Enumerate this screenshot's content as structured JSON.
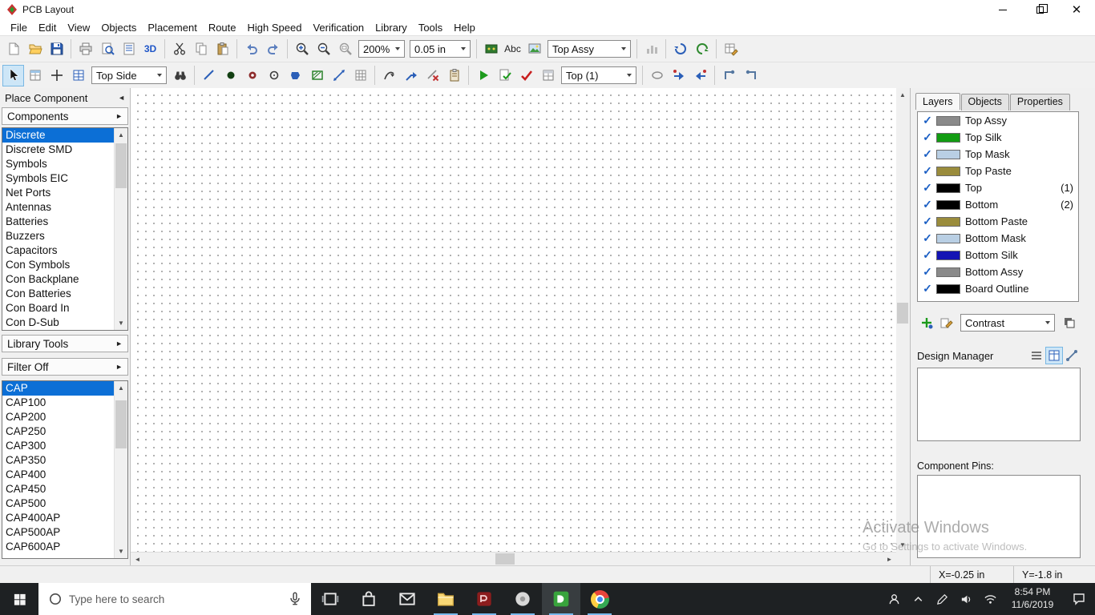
{
  "window": {
    "title": "PCB Layout"
  },
  "menu": {
    "items": [
      "File",
      "Edit",
      "View",
      "Objects",
      "Placement",
      "Route",
      "High Speed",
      "Verification",
      "Library",
      "Tools",
      "Help"
    ]
  },
  "toolbar_top": {
    "zoom": "200%",
    "grid": "0.05 in",
    "layer": "Top Assy",
    "view3d_label": "3D",
    "text_label": "Abc"
  },
  "toolbar_draw": {
    "side": "Top Side",
    "signal_layer": "Top (1)"
  },
  "left_panel": {
    "header": "Place Component",
    "components_label": "Components",
    "categories": [
      {
        "label": "Discrete",
        "selected": true
      },
      {
        "label": "Discrete SMD"
      },
      {
        "label": "Symbols"
      },
      {
        "label": "Symbols EIC"
      },
      {
        "label": "Net Ports"
      },
      {
        "label": "Antennas"
      },
      {
        "label": "Batteries"
      },
      {
        "label": "Buzzers"
      },
      {
        "label": "Capacitors"
      },
      {
        "label": "Con Symbols"
      },
      {
        "label": "Con Backplane"
      },
      {
        "label": "Con Batteries"
      },
      {
        "label": "Con Board In"
      },
      {
        "label": "Con D-Sub"
      }
    ],
    "library_tools_label": "Library Tools",
    "filter_label": "Filter Off",
    "parts": [
      {
        "label": "CAP",
        "selected": true
      },
      {
        "label": "CAP100"
      },
      {
        "label": "CAP200"
      },
      {
        "label": "CAP250"
      },
      {
        "label": "CAP300"
      },
      {
        "label": "CAP350"
      },
      {
        "label": "CAP400"
      },
      {
        "label": "CAP450"
      },
      {
        "label": "CAP500"
      },
      {
        "label": "CAP400AP"
      },
      {
        "label": "CAP500AP"
      },
      {
        "label": "CAP600AP"
      }
    ]
  },
  "right_panel": {
    "tabs": [
      {
        "label": "Layers",
        "active": true
      },
      {
        "label": "Objects"
      },
      {
        "label": "Properties"
      }
    ],
    "layers": [
      {
        "name": "Top Assy",
        "color": "#8a8a8a",
        "num": ""
      },
      {
        "name": "Top Silk",
        "color": "#129c12",
        "num": ""
      },
      {
        "name": "Top Mask",
        "color": "#b9cfe4",
        "num": ""
      },
      {
        "name": "Top Paste",
        "color": "#9a8c3c",
        "num": ""
      },
      {
        "name": "Top",
        "color": "#000000",
        "num": "(1)"
      },
      {
        "name": "Bottom",
        "color": "#000000",
        "num": "(2)"
      },
      {
        "name": "Bottom Paste",
        "color": "#9a8c3c",
        "num": ""
      },
      {
        "name": "Bottom Mask",
        "color": "#b9cfe4",
        "num": ""
      },
      {
        "name": "Bottom Silk",
        "color": "#1414b4",
        "num": ""
      },
      {
        "name": "Bottom Assy",
        "color": "#8a8a8a",
        "num": ""
      },
      {
        "name": "Board Outline",
        "color": "#000000",
        "num": ""
      }
    ],
    "contrast": "Contrast",
    "design_manager_label": "Design Manager",
    "component_pins_label": "Component Pins:"
  },
  "watermark": {
    "line1": "Activate Windows",
    "line2": "Go to Settings to activate Windows."
  },
  "status_bar": {
    "x": "X=-0.25 in",
    "y": "Y=-1.8 in"
  },
  "taskbar": {
    "search_placeholder": "Type here to search",
    "clock_time": "8:54 PM",
    "clock_date": "11/6/2019"
  },
  "colors": {
    "selection": "#0c6fd6",
    "layer_check": "#1b5fc4"
  }
}
